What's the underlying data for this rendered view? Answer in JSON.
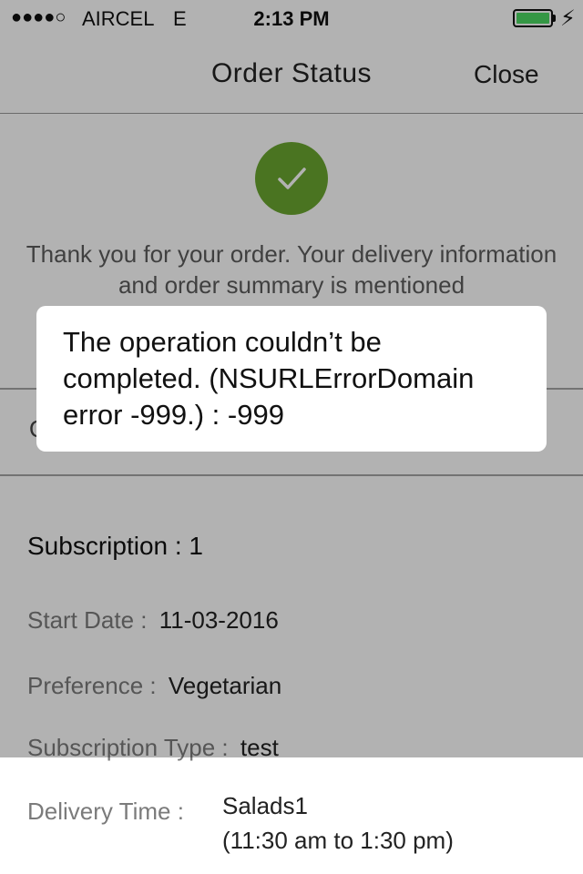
{
  "status_bar": {
    "signal": "●●●●○",
    "carrier": "AIRCEL",
    "network": "E",
    "time": "2:13 PM",
    "charging_icon": "⚡",
    "battery_color": "#4cd964"
  },
  "nav": {
    "title": "Order Status",
    "close_label": "Close"
  },
  "success": {
    "icon": "checkmark-icon",
    "color": "#6aa730",
    "message": "Thank you for your order. Your delivery information and order summary is mentioned"
  },
  "order_peek": "O",
  "subscription": {
    "title": "Subscription : 1",
    "start_date_label": "Start Date :",
    "start_date_value": "11-03-2016",
    "preference_label": "Preference :",
    "preference_value": "Vegetarian",
    "type_label": "Subscription Type :",
    "type_value": "test",
    "delivery_time_label": "Delivery Time :",
    "delivery_time_line1": "Salads1",
    "delivery_time_line2": "(11:30 am to 1:30 pm)"
  },
  "alert": {
    "message": "The operation couldn’t be completed. (NSURLErrorDomain error -999.) : -999"
  }
}
